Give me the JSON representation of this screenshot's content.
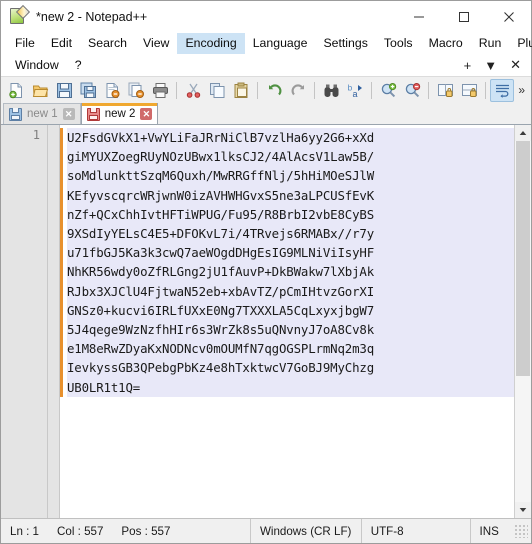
{
  "window": {
    "title": "*new 2 - Notepad++",
    "app_icon": "notepad-plus-plus-icon",
    "minimize_label": "─",
    "maximize_label": "□",
    "close_label": "✕"
  },
  "menu": {
    "row1": [
      {
        "label": "File",
        "active": false
      },
      {
        "label": "Edit",
        "active": false
      },
      {
        "label": "Search",
        "active": false
      },
      {
        "label": "View",
        "active": false
      },
      {
        "label": "Encoding",
        "active": true
      },
      {
        "label": "Language",
        "active": false
      },
      {
        "label": "Settings",
        "active": false
      },
      {
        "label": "Tools",
        "active": false
      },
      {
        "label": "Macro",
        "active": false
      },
      {
        "label": "Run",
        "active": false
      },
      {
        "label": "Plugins",
        "active": false
      }
    ],
    "row2": [
      {
        "label": "Window",
        "active": false
      },
      {
        "label": "?",
        "active": false
      }
    ],
    "right_controls": [
      {
        "label": "+",
        "name": "new-tab-plus-icon"
      },
      {
        "label": "▼",
        "name": "tab-list-chevron-icon"
      },
      {
        "label": "✕",
        "name": "close-document-icon"
      }
    ]
  },
  "toolbar": {
    "overflow_label": "»",
    "buttons": [
      {
        "name": "new-file-icon",
        "active": false
      },
      {
        "name": "open-file-icon",
        "active": false
      },
      {
        "name": "save-icon",
        "active": false
      },
      {
        "name": "save-all-icon",
        "active": false
      },
      {
        "name": "close-file-icon",
        "active": false
      },
      {
        "name": "close-all-files-icon",
        "active": false
      },
      {
        "name": "print-icon",
        "active": false
      },
      {
        "name": "cut-icon",
        "active": false
      },
      {
        "name": "copy-icon",
        "active": false
      },
      {
        "name": "paste-icon",
        "active": false
      },
      {
        "name": "undo-icon",
        "active": false
      },
      {
        "name": "redo-icon",
        "active": false
      },
      {
        "name": "find-icon",
        "active": false
      },
      {
        "name": "replace-icon",
        "active": false
      },
      {
        "name": "zoom-in-icon",
        "active": false
      },
      {
        "name": "zoom-out-icon",
        "active": false
      },
      {
        "name": "sync-vertical-scroll-icon",
        "active": false
      },
      {
        "name": "sync-horizontal-scroll-icon",
        "active": false
      },
      {
        "name": "word-wrap-icon",
        "active": true
      }
    ]
  },
  "tabs": [
    {
      "label": "new 1",
      "active": false,
      "modified": false,
      "close_label": "✕"
    },
    {
      "label": "new 2",
      "active": true,
      "modified": true,
      "close_label": "✕"
    }
  ],
  "editor": {
    "line_numbers": [
      "1"
    ],
    "lines": [
      "U2FsdGVkX1+VwYLiFaJRrNiClB7vzlHa6yy2G6+xXd",
      "giMYUXZoegRUyNOzUBwx1lksCJ2/4AlAcsV1Law5B/",
      "soMdlunkttSzqM6Quxh/MwRRGffNlj/5hHiMOeSJlW",
      "KEfyvscqrcWRjwnW0izAVHWHGvxS5ne3aLPCUSfEvK",
      "nZf+QCxChhIvtHFTiWPUG/Fu95/R8BrbI2vbE8CyBS",
      "9XSdIyYELsC4E5+DFOKvL7i/4TRvejs6RMABx//r7y",
      "u71fbGJ5Ka3k3cwQ7aeWOgdDHgEsIG9MLNiViIsyHF",
      "NhKR56wdy0oZfRLGng2jU1fAuvP+DkBWakw7lXbjAk",
      "RJbx3XJClU4FjtwaN52eb+xbAvTZ/pCmIHtvzGorXI",
      "GNSz0+kucvi6IRLfUXxE0Ng7TXXXLA5CqLxyxjbgW7",
      "5J4qege9WzNzfhHIr6s3WrZk8s5uQNvnyJ7oA8Cv8k",
      "e1M8eRwZDyaKxNODNcv0mOUMfN7qgOGSPLrmNq2m3q",
      "IevkyssGB3QPebgPbKz4e8hTxktwcV7GoBJ9MyChzg",
      "UB0LR1t1Q="
    ]
  },
  "scrollbar": {
    "up_label": "▲",
    "down_label": "▼"
  },
  "statusbar": {
    "line": "Ln : 1",
    "col": "Col : 557",
    "pos": "Pos : 557",
    "eol": "Windows (CR LF)",
    "encoding": "UTF-8",
    "insert_mode": "INS"
  },
  "colors": {
    "accent_orange": "#f0a830",
    "menu_highlight": "#cde3f5",
    "current_line": "#e8e8f8"
  }
}
